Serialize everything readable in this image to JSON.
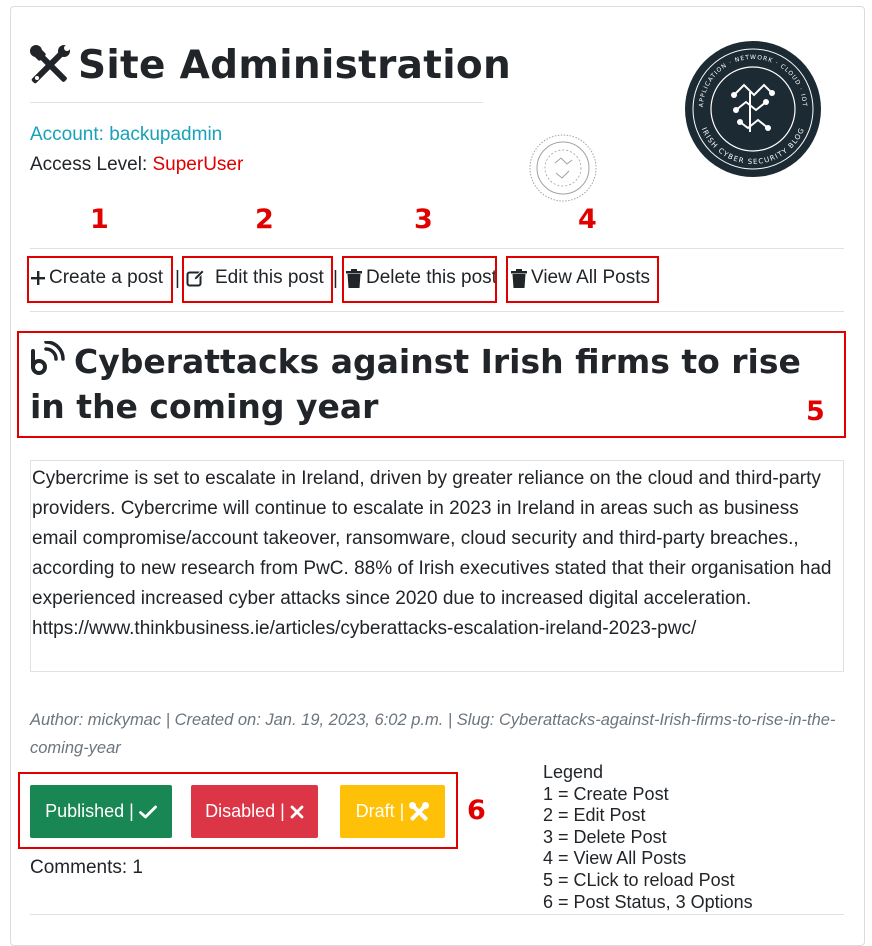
{
  "header": {
    "title": "Site Administration",
    "account": "Account: backupadmin",
    "access_label": "Access Level: ",
    "access_value": "SuperUser"
  },
  "annotations": {
    "n1": "1",
    "n2": "2",
    "n3": "3",
    "n4": "4",
    "n5": "5",
    "n6": "6"
  },
  "actions": {
    "create": "Create a post",
    "edit": "Edit this post",
    "delete": "Delete this post",
    "view_all": "View All Posts",
    "separator": "|"
  },
  "post": {
    "title": "Cyberattacks against Irish firms to rise in the coming year",
    "body": "Cybercrime is set to escalate in Ireland, driven by greater reliance on the cloud and third-party providers. Cybercrime will continue to escalate in 2023 in Ireland in areas such as business email compromise/account takeover, ransomware, cloud security and third-party breaches., according to new research from PwC. 88% of Irish executives stated that their organisation had experienced increased cyber attacks since 2020 due to increased digital acceleration. https://www.thinkbusiness.ie/articles/cyberattacks-escalation-ireland-2023-pwc/",
    "meta": "Author: mickymac | Created on: Jan. 19, 2023, 6:02 p.m. | Slug: Cyberattacks-against-Irish-firms-to-rise-in-the-coming-year",
    "comments": "Comments: 1"
  },
  "status_buttons": {
    "published": "Published |",
    "disabled": "Disabled |",
    "draft": "Draft |"
  },
  "legend": {
    "title": "Legend",
    "items": [
      "1 = Create Post",
      "2 = Edit Post",
      "3 = Delete Post",
      "4 = View All Posts",
      "5 = CLick to reload Post",
      "6 = Post Status, 3 Options"
    ]
  },
  "logo": {
    "ring_top": "APPLICATION · NETWORK · CLOUD · IOT",
    "ring_bottom": "IRISH CYBER SECURITY BLOG"
  },
  "colors": {
    "account": "#17a2b8",
    "superuser": "#e00000",
    "annotation_red": "#e00000",
    "published": "#198754",
    "disabled": "#dc3545",
    "draft": "#ffc107"
  },
  "icons": {
    "title": "tools-icon",
    "create": "plus-icon",
    "edit": "pencil-square-icon",
    "delete": "trash-icon",
    "view_all": "trash-icon",
    "post": "rss-icon",
    "published": "check-icon",
    "disabled": "x-icon",
    "draft": "tools-icon"
  }
}
